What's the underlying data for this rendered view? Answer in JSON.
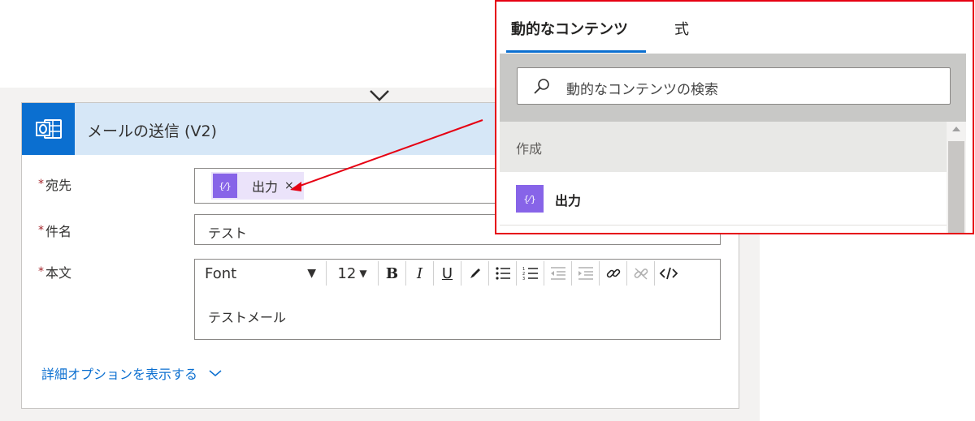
{
  "card": {
    "title": "メールの送信 (V2)",
    "header_color": "#d6e7f7",
    "icon": "outlook-icon",
    "required_mark": "*",
    "to": {
      "label": "宛先",
      "token_label": "出力",
      "token_icon": "expression-icon",
      "token_remove": "×"
    },
    "subject": {
      "label": "件名",
      "value": "テスト"
    },
    "body": {
      "label": "本文",
      "font_label": "Font",
      "font_size": "12",
      "text": "テストメール",
      "buttons": [
        "bold",
        "italic",
        "underline",
        "highlight",
        "bulleted-list",
        "numbered-list",
        "decrease-indent",
        "increase-indent",
        "link",
        "unlink",
        "code-view"
      ]
    },
    "advanced_link": "詳細オプションを表示する"
  },
  "dynamic_panel": {
    "tabs": [
      {
        "label": "動的なコンテンツ",
        "active": true
      },
      {
        "label": "式",
        "active": false
      }
    ],
    "search_placeholder": "動的なコンテンツの検索",
    "section_label": "作成",
    "items": [
      {
        "label": "出力",
        "icon": "expression-icon"
      }
    ],
    "highlight_color": "#e60012",
    "accent_color": "#0b6fd0",
    "token_color": "#8764e8"
  }
}
